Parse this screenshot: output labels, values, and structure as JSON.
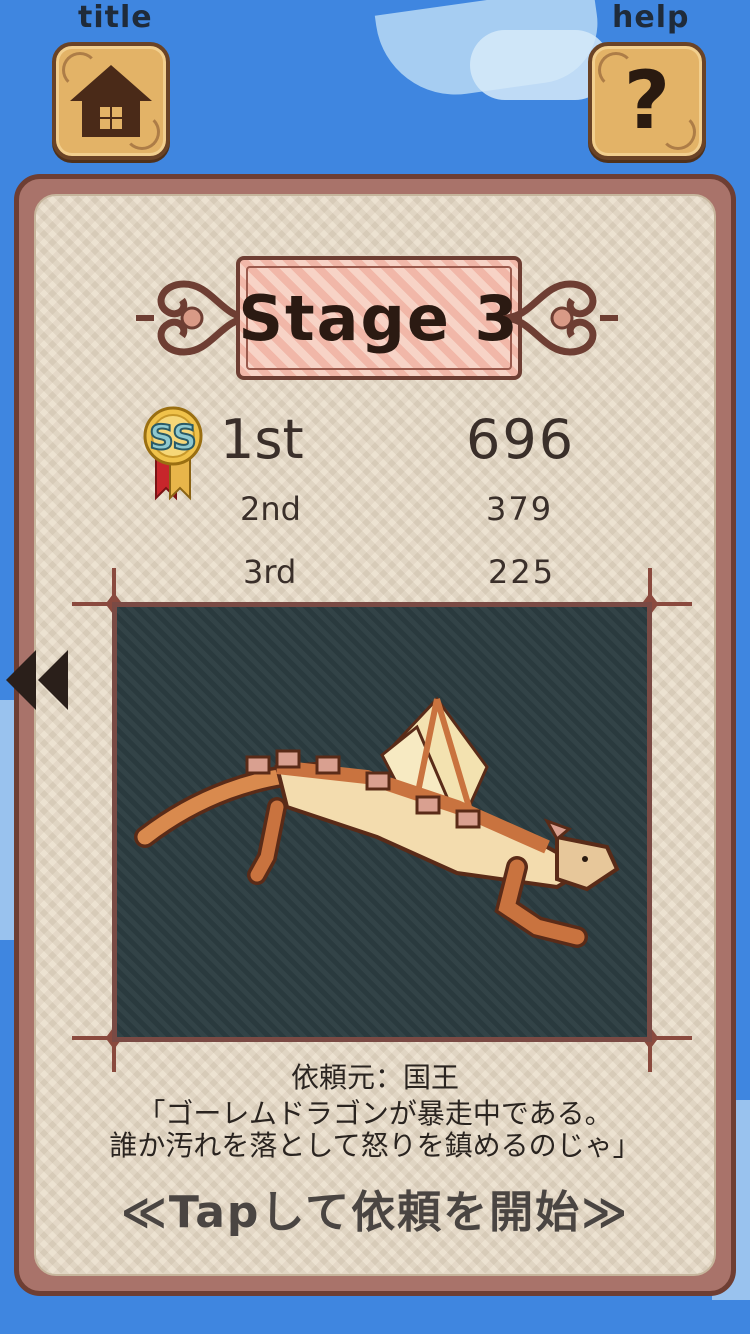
{
  "header": {
    "title_label": "title",
    "help_label": "help",
    "home_icon": "house-icon",
    "help_icon": "question-mark-icon"
  },
  "stage": {
    "name": "Stage 3"
  },
  "rankings": [
    {
      "rank": "1st",
      "score": "696",
      "medal": "SS"
    },
    {
      "rank": "2nd",
      "score": "379"
    },
    {
      "rank": "3rd",
      "score": "225"
    }
  ],
  "navigation": {
    "prev_icon": "double-left-arrow-icon"
  },
  "request": {
    "client_line": "依頼元：国王",
    "message_line1": "「ゴーレムドラゴンが暴走中である。",
    "message_line2": "誰か汚れを落として怒りを鎮めるのじゃ」"
  },
  "start_prompt": "≪Tapして依頼を開始≫",
  "colors": {
    "sky": "#3f86e0",
    "panel": "#e7dac5",
    "frame": "#a9736a",
    "art_background": "#2c3d41",
    "dragon": "#c9733f"
  }
}
